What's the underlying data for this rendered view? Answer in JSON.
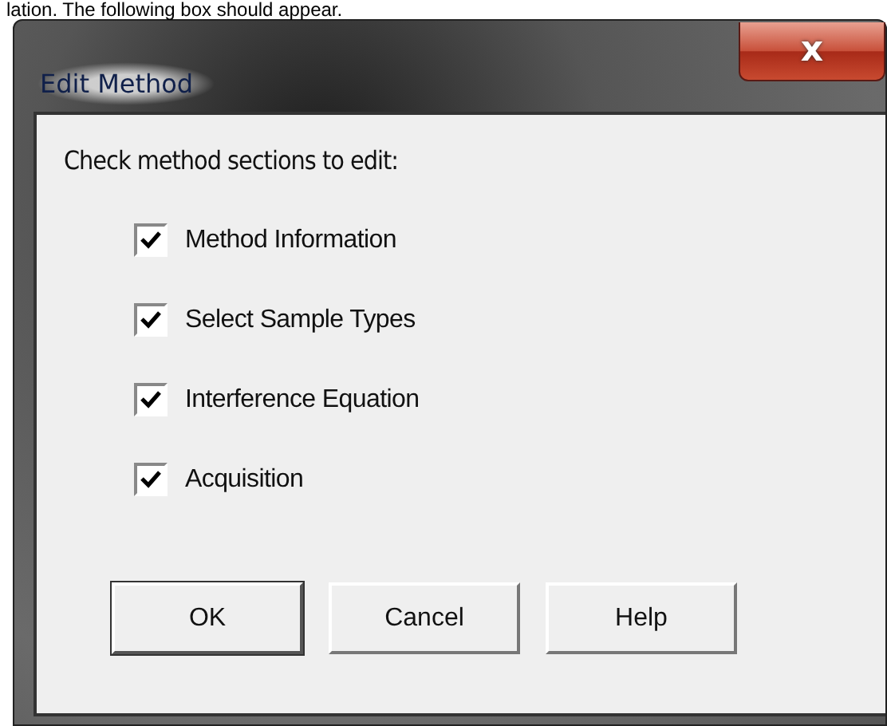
{
  "document_text": "lation. The following box should appear.",
  "window": {
    "title": "Edit Method",
    "close": "x"
  },
  "prompt": "Check method sections to edit:",
  "options": [
    {
      "label": "Method Information",
      "checked": true
    },
    {
      "label": "Select Sample Types",
      "checked": true
    },
    {
      "label": "Interference Equation",
      "checked": true
    },
    {
      "label": "Acquisition",
      "checked": true
    }
  ],
  "buttons": [
    {
      "label": "OK",
      "default": true
    },
    {
      "label": "Cancel",
      "default": false
    },
    {
      "label": "Help",
      "default": false
    }
  ]
}
